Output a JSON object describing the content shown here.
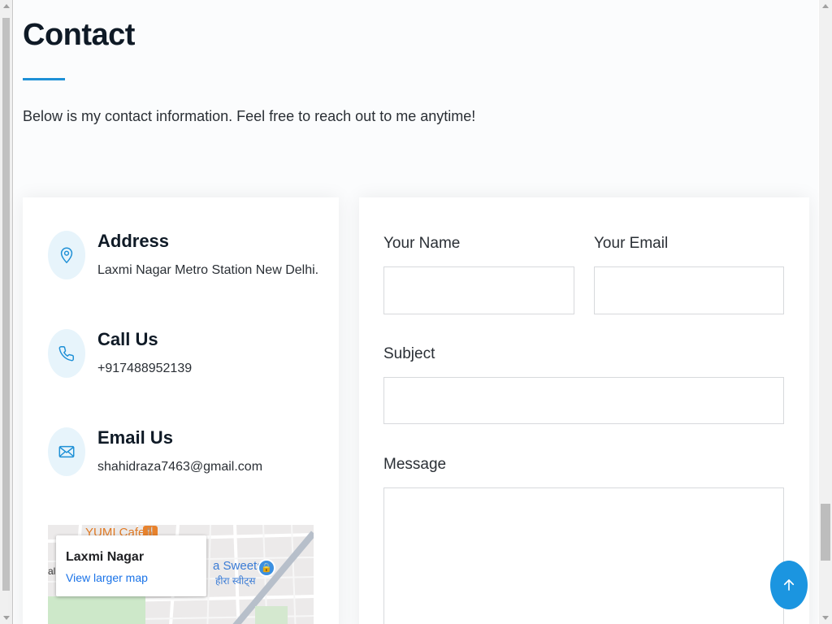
{
  "section": {
    "title": "Contact",
    "intro": "Below is my contact information. Feel free to reach out to me anytime!"
  },
  "info": {
    "address": {
      "heading": "Address",
      "text": "Laxmi Nagar Metro Station New Delhi.",
      "icon": "map-pin-icon"
    },
    "call": {
      "heading": "Call Us",
      "text": "+917488952139",
      "icon": "phone-icon"
    },
    "email": {
      "heading": "Email Us",
      "text": "shahidraza7463@gmail.com",
      "icon": "envelope-icon"
    }
  },
  "map": {
    "place": "Laxmi Nagar",
    "larger_link": "View larger map",
    "label_cafe": "YUMI Cafe",
    "label_sweets": "a Sweets",
    "label_sweets_hindi": "हीरा स्वीट्स",
    "label_edge": "al"
  },
  "form": {
    "name_label": "Your Name",
    "email_label": "Your Email",
    "subject_label": "Subject",
    "message_label": "Message"
  },
  "colors": {
    "accent": "#1e90d6",
    "icon_bg": "#e7f4fb",
    "link": "#1a73e8"
  },
  "back_to_top": {
    "icon": "arrow-up-icon"
  }
}
